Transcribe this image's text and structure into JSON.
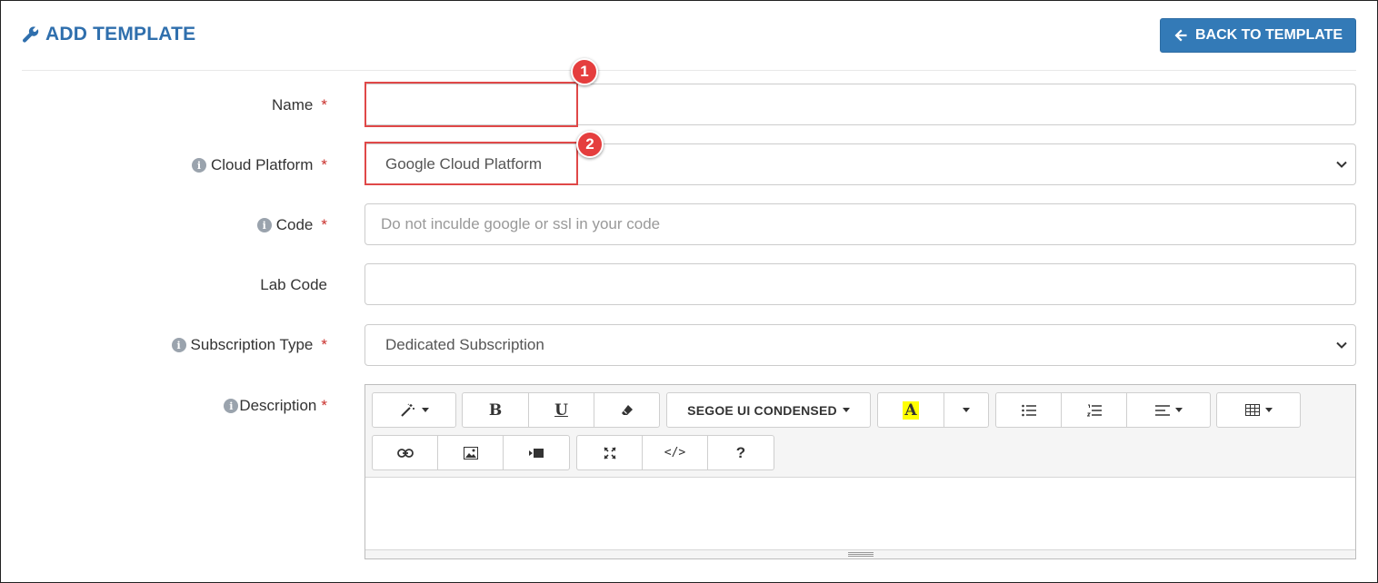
{
  "header": {
    "title": "ADD TEMPLATE",
    "back_label": "BACK TO TEMPLATE",
    "accent": "#2f6fad",
    "button_color": "#337ab7"
  },
  "form": {
    "name": {
      "label": "Name",
      "required": "*",
      "value": ""
    },
    "cloud_platform": {
      "label": "Cloud Platform",
      "required": "*",
      "selected": "Google Cloud Platform"
    },
    "code": {
      "label": "Code",
      "required": "*",
      "placeholder": "Do not inculde google or ssl in your code"
    },
    "lab_code": {
      "label": "Lab Code",
      "value": ""
    },
    "subscription_type": {
      "label": "Subscription Type",
      "required": "*",
      "selected": "Dedicated Subscription"
    },
    "description": {
      "label": "Description",
      "required": "*"
    }
  },
  "editor": {
    "font_name": "SEGOE UI CONDENSED",
    "bold_glyph": "B",
    "underline_glyph": "U",
    "color_glyph": "A",
    "code_glyph": "</>",
    "help_glyph": "?",
    "icons": [
      "magic-icon",
      "bold-icon",
      "underline-icon",
      "eraser-icon",
      "font-color-icon",
      "bullet-list-icon",
      "numbered-list-icon",
      "align-icon",
      "table-icon",
      "link-icon",
      "image-icon",
      "video-icon",
      "fullscreen-icon",
      "code-view-icon",
      "help-icon"
    ]
  },
  "annotations": {
    "badge_1": "1",
    "badge_2": "2",
    "color": "#e04848"
  }
}
